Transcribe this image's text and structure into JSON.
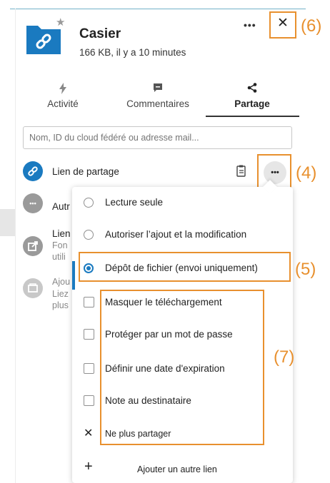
{
  "header": {
    "file_name": "Casier",
    "file_meta": "166 KB, il y a 10 minutes",
    "more_label": "•••",
    "close_label": "✕",
    "folder_icon": "folder-link-icon",
    "favorite_icon": "star-icon"
  },
  "tabs": [
    {
      "label": "Activité",
      "icon": "bolt-icon",
      "active": false
    },
    {
      "label": "Commentaires",
      "icon": "comment-icon",
      "active": false
    },
    {
      "label": "Partage",
      "icon": "share-icon",
      "active": true
    }
  ],
  "search": {
    "placeholder": "Nom, ID du cloud fédéré ou adresse mail..."
  },
  "share_link": {
    "label": "Lien de partage",
    "more_label": "•••"
  },
  "rows": {
    "other_label": "Autr",
    "internal_title": "Lien",
    "internal_sub1": "Fon",
    "internal_sub2": "utili",
    "add_title": "Ajou",
    "add_sub1": "Liez",
    "add_sub2": "plus"
  },
  "menu": {
    "read_only": "Lecture seule",
    "allow_upload_edit": "Autoriser l’ajout et la modification",
    "file_drop": "Dépôt de fichier (envoi uniquement)",
    "hide_download": "Masquer le téléchargement",
    "password_protect": "Protéger par un mot de passe",
    "expiration_date": "Définir une date d'expiration",
    "note_recipient": "Note au destinataire",
    "unshare": "Ne plus partager",
    "add_link": "Ajouter un autre lien",
    "selected": "file_drop"
  },
  "annotations": {
    "label_4": "(4)",
    "label_5": "(5)",
    "label_6": "(6)",
    "label_7": "(7)",
    "color": "#e8902e"
  },
  "colors": {
    "accent": "#1a7ac0",
    "callout": "#e8902e",
    "icon_grey": "#9a9a9a"
  }
}
